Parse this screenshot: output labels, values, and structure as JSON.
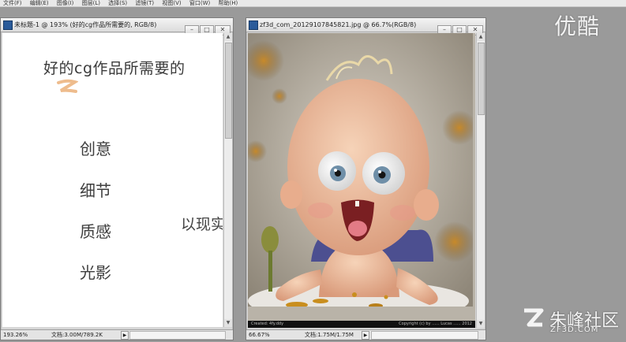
{
  "menubar": {
    "items": [
      "文件(F)",
      "编辑(E)",
      "图像(I)",
      "图层(L)",
      "选择(S)",
      "滤镜(T)",
      "视图(V)",
      "窗口(W)",
      "帮助(H)"
    ]
  },
  "left_window": {
    "title": "未标题-1 @ 193% (好的cg作品所需要的, RGB/8)",
    "document": {
      "heading": "好的cg作品所需要的",
      "items": [
        "创意",
        "细节",
        "质感",
        "光影"
      ],
      "partial_text": "以现实"
    },
    "status": {
      "zoom": "193.26%",
      "doc_info": "文档:3.00M/789.2K"
    }
  },
  "right_window": {
    "title": "zf3d_com_20129107845821.jpg @ 66.7%(RGB/8)",
    "image_caption_left": "Created: 4fy.ddy",
    "image_caption_right": "Copyright (c) by ...... Lucas ...... 2012",
    "status": {
      "zoom": "66.67%",
      "doc_info": "文档:1.75M/1.75M"
    }
  },
  "watermarks": {
    "youku": "优酷",
    "zf_name": "朱峰社区",
    "zf_url": "ZF3D.COM"
  },
  "window_buttons": {
    "minimize": "–",
    "maximize": "□",
    "close": "✕"
  },
  "colors": {
    "workspace_bg": "#9a9a9a",
    "accent_orange": "#e8a567"
  }
}
